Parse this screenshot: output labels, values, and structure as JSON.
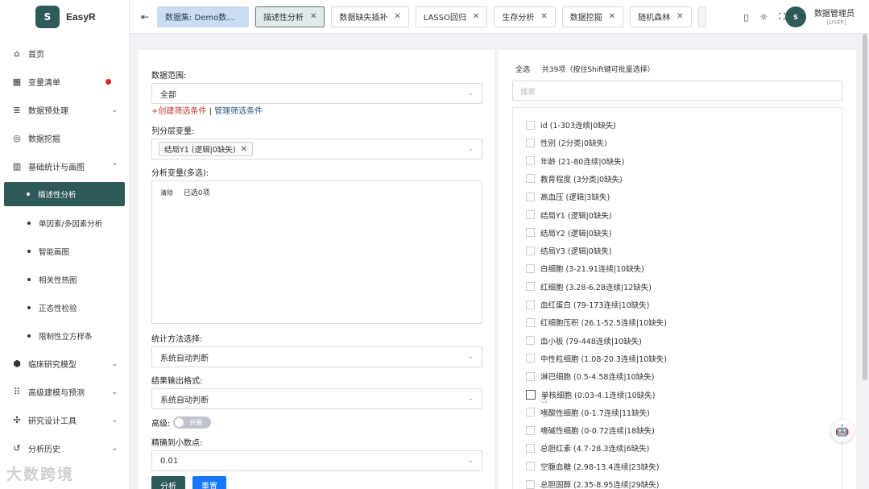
{
  "app": {
    "logo_mark": "S",
    "name": "EasyR"
  },
  "sidebar": {
    "items": [
      {
        "label": "首页",
        "icon": "home-icon"
      },
      {
        "label": "变量清单",
        "icon": "table-icon",
        "badge": "red-dot"
      },
      {
        "label": "数据预处理",
        "icon": "database-icon"
      },
      {
        "label": "数据挖掘",
        "icon": "mining-icon"
      },
      {
        "label": "基础统计与画图",
        "icon": "bar-chart-icon"
      }
    ],
    "subitems": [
      {
        "label": "描述性分析",
        "active": true
      },
      {
        "label": "单因素/多因素分析"
      },
      {
        "label": "智能画图"
      },
      {
        "label": "相关性热图"
      },
      {
        "label": "正态性检验"
      },
      {
        "label": "限制性立方样条"
      }
    ],
    "items_after": [
      {
        "label": "临床研究模型",
        "icon": "cube-icon"
      },
      {
        "label": "高级建模与预测",
        "icon": "grid-icon"
      },
      {
        "label": "研究设计工具",
        "icon": "tools-icon"
      },
      {
        "label": "分析历史",
        "icon": "history-icon"
      }
    ]
  },
  "tabs": [
    {
      "label": "数据集: Demo数..."
    },
    {
      "label": "描述性分析"
    },
    {
      "label": "数据缺失插补"
    },
    {
      "label": "LASSO回归"
    },
    {
      "label": "生存分析"
    },
    {
      "label": "数据挖掘"
    },
    {
      "label": "随机森林"
    }
  ],
  "user": {
    "avatar_text": "S",
    "name": "数据管理员",
    "role": "[USER]"
  },
  "form": {
    "data_range_label": "数据范围:",
    "data_range_value": "全部",
    "create_filter": "+创建筛选条件",
    "separator": "|",
    "manage_filter": "管理筛选条件",
    "strat_label": "列分层变量:",
    "strat_chip": "结局Y1 (逻辑|0缺失)",
    "vars_label": "分析变量(多选):",
    "vars_clear": "清除",
    "vars_selected": "已选0项",
    "method_label": "统计方法选择:",
    "method_value": "系统自动判断",
    "output_label": "结果输出格式:",
    "output_value": "系统自动判断",
    "advanced_label": "高级:",
    "advanced_toggle": "折叠",
    "decimal_label": "精确到小数点:",
    "decimal_value": "0.01",
    "analyze_button": "分析",
    "reset_button": "重置"
  },
  "selector": {
    "select_all": "全选",
    "count_text": "共39项（按住Shift键可批量选择）",
    "search_placeholder": "搜索",
    "options": [
      "id (1-303连续|0缺失)",
      "性别 (2分类|0缺失)",
      "年龄 (21-80连续|0缺失)",
      "教育程度 (3分类|0缺失)",
      "高血压 (逻辑|3缺失)",
      "结局Y1 (逻辑|0缺失)",
      "结局Y2 (逻辑|0缺失)",
      "结局Y3 (逻辑|0缺失)",
      "白细胞 (3-21.91连续|10缺失)",
      "红细胞 (3.28-6.28连续|12缺失)",
      "血红蛋白 (79-173连续|10缺失)",
      "红细胞压积 (26.1-52.5连续|10缺失)",
      "血小板 (79-448连续|10缺失)",
      "中性粒细胞 (1.08-20.3连续|10缺失)",
      "淋巴细胞 (0.5-4.58连续|10缺失)",
      "单核细胞 (0.03-4.1连续|10缺失)",
      "嗜酸性细胞 (0-1.7连续|11缺失)",
      "嗜碱性细胞 (0-0.72连续|18缺失)",
      "总胆红素 (4.7-28.3连续|6缺失)",
      "空腹血糖 (2.98-13.4连续|23缺失)",
      "总胆固醇 (2.35-8.95连续|29缺失)"
    ]
  },
  "watermark": "大数跨境"
}
